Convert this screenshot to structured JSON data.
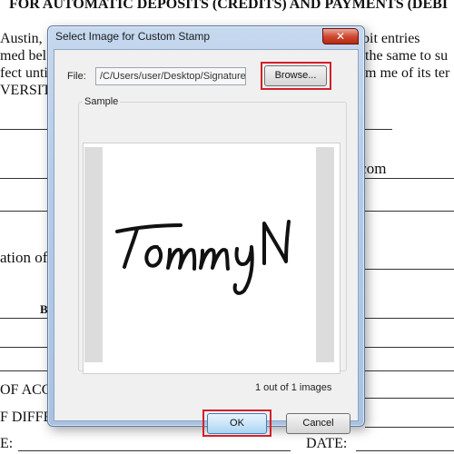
{
  "document": {
    "heading": "FOR AUTOMATIC DEPOSITS (CREDITS) AND PAYMENTS (DEBI",
    "line1_left": "Austin,",
    "line1_right": "VERSITY, to initiate credit and debit entries",
    "line2_left": "med bel",
    "line2_right": "the same to su",
    "line3_left": "fect unti",
    "line3_right": "m me of its ter",
    "line4_left": "VERSIT",
    "email_fragment": "ail.com",
    "ation_fragment": "ation of",
    "b_fragment": "B",
    "acc_fragment": "OF ACC",
    "differ_fragment": "F DIFFE",
    "e_fragment": "E:",
    "date_label": "DATE:"
  },
  "dialog": {
    "title": "Select Image for Custom Stamp",
    "close_glyph": "✕",
    "file_label": "File:",
    "file_path": "/C/Users/user/Desktop/Signature",
    "browse_label": "Browse...",
    "sample_label": "Sample",
    "signature_text": "Tommy N",
    "count_text": "1 out of 1 images",
    "ok_label": "OK",
    "cancel_label": "Cancel"
  },
  "colors": {
    "highlight": "#d3202a",
    "title_bar": "#b9cfea"
  },
  "icons": [
    "close-icon"
  ]
}
